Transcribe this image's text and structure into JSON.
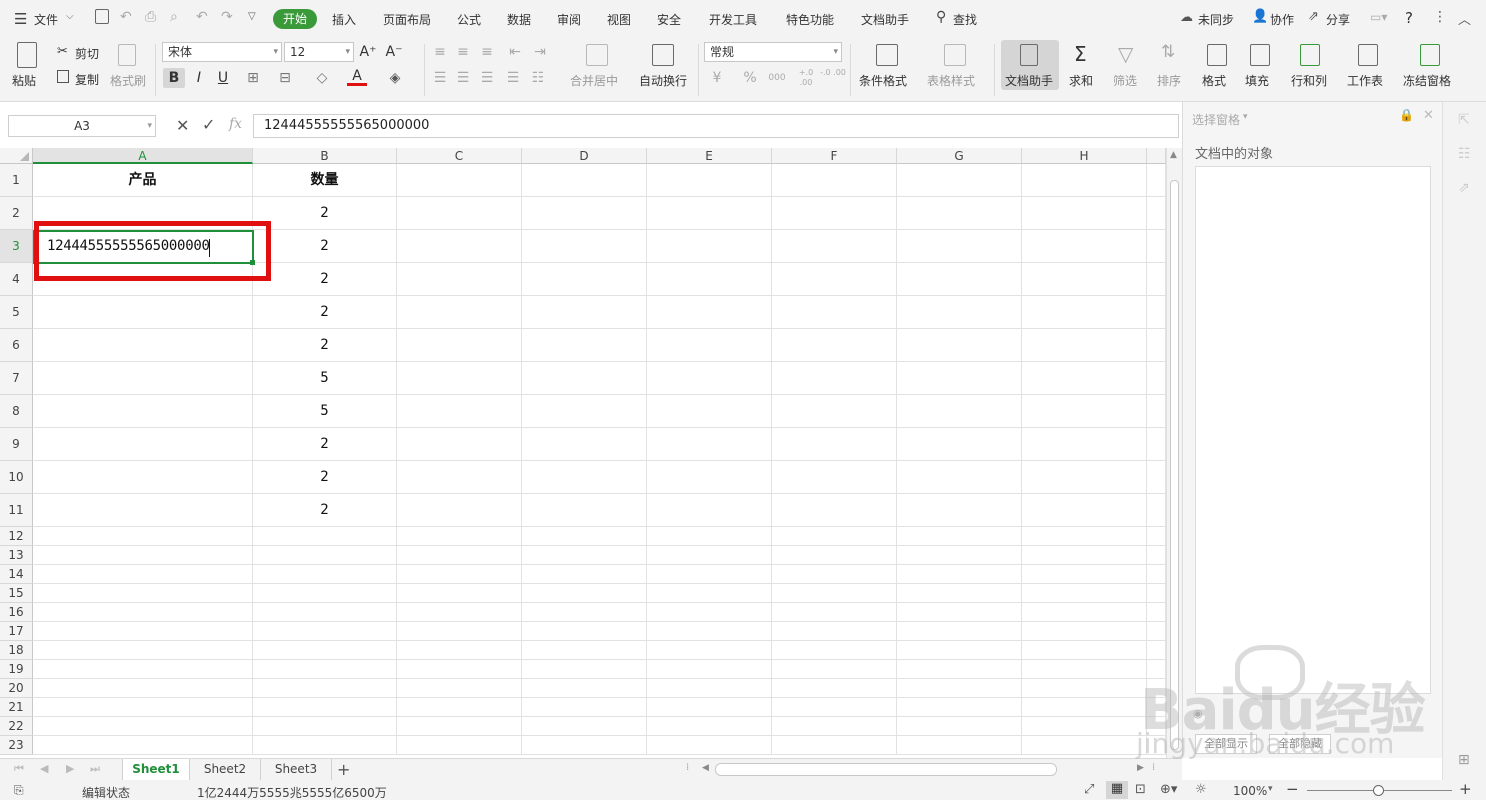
{
  "menubar": {
    "file": "文件",
    "tabs": [
      "开始",
      "插入",
      "页面布局",
      "公式",
      "数据",
      "审阅",
      "视图",
      "安全",
      "开发工具",
      "特色功能",
      "文档助手"
    ],
    "search": "查找",
    "unsync": "未同步",
    "collab": "协作",
    "share": "分享",
    "help": "?"
  },
  "ribbon": {
    "paste": "粘贴",
    "cut": "剪切",
    "copy": "复制",
    "format_painter": "格式刷",
    "font_name": "宋体",
    "font_size": "12",
    "bold": "B",
    "italic": "I",
    "underline": "U",
    "font_color_glyph": "A",
    "merge_center": "合并居中",
    "wrap_text": "自动换行",
    "number_format": "常规",
    "percent": "%",
    "thousands": "000",
    "inc_decimal": "+.0 .00",
    "dec_decimal": "-.0 .00",
    "conditional_format": "条件格式",
    "table_style": "表格样式",
    "doc_assistant": "文档助手",
    "sum": "求和",
    "filter": "筛选",
    "sort": "排序",
    "format": "格式",
    "fill": "填充",
    "rows_cols": "行和列",
    "worksheet": "工作表",
    "freeze": "冻结窗格"
  },
  "formula_bar": {
    "name_box": "A3",
    "fx": "fx",
    "content": "12444555555565000000"
  },
  "sheet": {
    "columns": [
      "A",
      "B",
      "C",
      "D",
      "E",
      "F",
      "G",
      "H"
    ],
    "row_numbers": [
      "1",
      "2",
      "3",
      "4",
      "5",
      "6",
      "7",
      "8",
      "9",
      "10",
      "11",
      "12",
      "13",
      "14",
      "15",
      "16",
      "17",
      "18",
      "19",
      "20",
      "21",
      "22",
      "23"
    ],
    "header_product": "产品",
    "header_qty": "数量",
    "a3_value": "12444555555565000000",
    "qty_values": [
      "2",
      "2",
      "2",
      "2",
      "2",
      "5",
      "5",
      "2",
      "2",
      "2"
    ]
  },
  "sheet_tabs": [
    "Sheet1",
    "Sheet2",
    "Sheet3"
  ],
  "status": {
    "mode": "编辑状态",
    "readout": "1亿2444万5555兆5555亿6500万",
    "zoom": "100%"
  },
  "pane": {
    "title": "选择窗格",
    "subtitle": "文档中的对象",
    "show_all": "全部显示",
    "hide_all": "全部隐藏"
  },
  "watermark": {
    "brand": "Baidu经验",
    "url": "jingyan.baidu.com"
  },
  "colors": {
    "accent_green": "#3a9a3a",
    "highlight_red": "#e01010",
    "selection_green": "#1f8f3a"
  }
}
